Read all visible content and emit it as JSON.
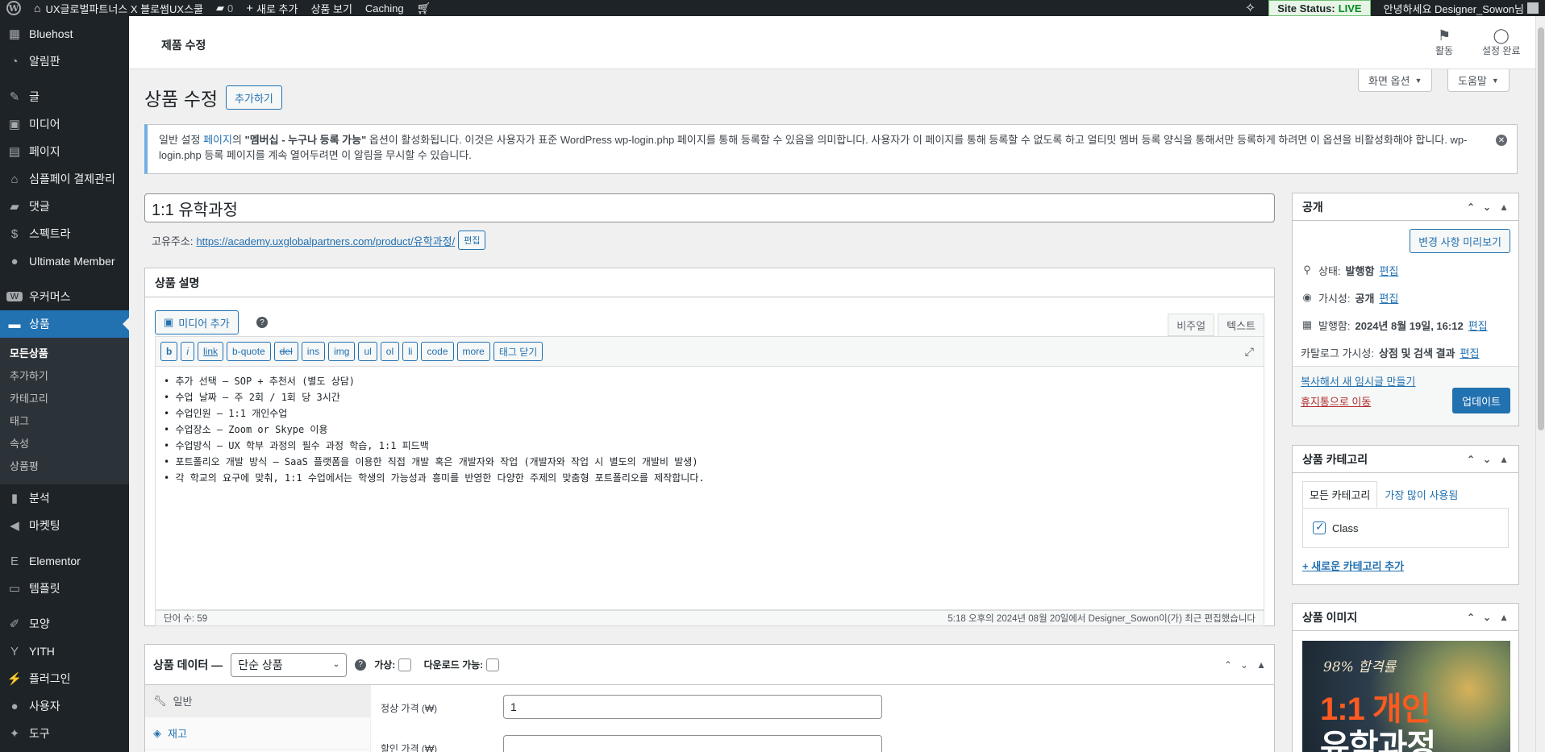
{
  "adminbar": {
    "site_name": "UX글로벌파트너스 X 블로썸UX스쿨",
    "comments_count": "0",
    "new_label": "새로 추가",
    "view_product": "상품 보기",
    "caching": "Caching",
    "site_status_label": "Site Status:",
    "site_status_value": "LIVE",
    "greeting": "안녕하세요 Designer_Sowon님"
  },
  "sidebar": {
    "items": [
      {
        "label": "Bluehost",
        "icon": "grid-icon",
        "glyph": "▦"
      },
      {
        "label": "알림판",
        "icon": "dashboard-icon",
        "glyph": "◔"
      },
      {
        "label": "글",
        "icon": "pin-icon",
        "glyph": "✎"
      },
      {
        "label": "미디어",
        "icon": "media-icon",
        "glyph": "▣"
      },
      {
        "label": "페이지",
        "icon": "page-icon",
        "glyph": "▤"
      },
      {
        "label": "심플페이 결제관리",
        "icon": "bank-icon",
        "glyph": "⌂"
      },
      {
        "label": "댓글",
        "icon": "comment-icon",
        "glyph": "▰"
      },
      {
        "label": "스펙트라",
        "icon": "spectra-icon",
        "glyph": "$"
      },
      {
        "label": "Ultimate Member",
        "icon": "user-icon",
        "glyph": "●"
      },
      {
        "label": "우커머스",
        "icon": "woo-icon",
        "glyph": "W"
      },
      {
        "label": "상품",
        "icon": "archive-icon",
        "glyph": "▬"
      },
      {
        "label": "분석",
        "icon": "chart-icon",
        "glyph": "▮"
      },
      {
        "label": "마켓팅",
        "icon": "megaphone-icon",
        "glyph": "◀"
      },
      {
        "label": "Elementor",
        "icon": "elementor-icon",
        "glyph": "E"
      },
      {
        "label": "템플릿",
        "icon": "folder-icon",
        "glyph": "▭"
      },
      {
        "label": "모양",
        "icon": "brush-icon",
        "glyph": "✐"
      },
      {
        "label": "YITH",
        "icon": "yith-icon",
        "glyph": "Y"
      },
      {
        "label": "플러그인",
        "icon": "plugin-icon",
        "glyph": "⚡"
      },
      {
        "label": "사용자",
        "icon": "users-icon",
        "glyph": "●"
      },
      {
        "label": "도구",
        "icon": "tool-icon",
        "glyph": "✦"
      }
    ],
    "submenu": [
      "모든상품",
      "추가하기",
      "카테고리",
      "태그",
      "속성",
      "상품평"
    ]
  },
  "header": {
    "title": "제품 수정",
    "activity": "활동",
    "setup_done": "설정 완료",
    "screen_options": "화면 옵션",
    "help": "도움말"
  },
  "page": {
    "title": "상품 수정",
    "add_new": "추가하기"
  },
  "notice": {
    "part1": "일반 설정 ",
    "link": "페이지",
    "part2": "의 ",
    "bold": "\"멤버십 - 누구나 등록 가능\"",
    "part3": " 옵션이 활성화됩니다. 이것은 사용자가 표준 WordPress wp-login.php 페이지를 통해 등록할 수 있음을 의미합니다. 사용자가 이 페이지를 통해 등록할 수 없도록 하고 얼티밋 멤버 등록 양식을 통해서만 등록하게 하려면 이 옵션을 비활성화해야 합니다. wp-login.php 등록 페이지를 계속 열어두려면 이 알림을 무시할 수 있습니다."
  },
  "post": {
    "title": "1:1 유학과정",
    "permalink_label": "고유주소:",
    "permalink_url": "https://academy.uxglobalpartners.com/product/유학과정/",
    "edit": "편집"
  },
  "description": {
    "box_title": "상품 설명",
    "add_media": "미디어 추가",
    "tab_visual": "비주얼",
    "tab_text": "텍스트",
    "toolbar": [
      "b",
      "i",
      "link",
      "b-quote",
      "del",
      "ins",
      "img",
      "ul",
      "ol",
      "li",
      "code",
      "more",
      "태그 닫기"
    ],
    "lines": [
      "• 추가 선택 – SOP + 추천서 (별도 상담)",
      "• 수업 날짜 – 주 2회 / 1회 당 3시간",
      "• 수업인원 – 1:1 개인수업",
      "• 수업장소 – Zoom or Skype 이용",
      "• 수업방식 – UX 학부 과정의 필수 과정 학습, 1:1 피드백",
      "• 포트폴리오 개발 방식 – SaaS 플랫폼을 이용한 직접 개발 혹은 개발자와 작업 (개발자와 작업 시 별도의 개발비 발생)",
      "• 각 학교의 요구에 맞춰, 1:1 수업에서는 학생의 가능성과 흥미를 반영한 다양한 주제의 맞춤형 포트폴리오를 제작합니다."
    ],
    "word_count": "단어 수: 59",
    "last_edited": "5:18 오후의 2024년 08월 20일에서 Designer_Sowon이(가) 최근 편집했습니다"
  },
  "product_data": {
    "title": "상품 데이터 —",
    "type": "단순 상품",
    "virtual": "가상:",
    "downloadable": "다운로드 가능:",
    "tabs": [
      "일반",
      "재고"
    ],
    "regular_price_label": "정상 가격 (₩)",
    "regular_price": "1",
    "sale_price_label": "할인 가격 (₩)",
    "sale_price": ""
  },
  "publish": {
    "title": "공개",
    "preview": "변경 사항 미리보기",
    "status_label": "상태:",
    "status_value": "발행함",
    "visibility_label": "가시성:",
    "visibility_value": "공개",
    "published_label": "발행함:",
    "published_value": "2024년 8월 19일, 16:12",
    "catalog_label": "카탈로그 가시성:",
    "catalog_value": "상점 및 검색 결과",
    "edit": "편집",
    "copy_draft": "복사해서 새 임시글 만들기",
    "trash": "휴지통으로 이동",
    "update": "업데이트"
  },
  "categories": {
    "title": "상품 카테고리",
    "tab_all": "모든 카테고리",
    "tab_popular": "가장 많이 사용됨",
    "item": "Class",
    "add_new": "+ 새로운 카테고리 추가"
  },
  "product_image": {
    "title": "상품 이미지",
    "text1": "98% 합격률",
    "text2": "1:1 개인",
    "text3": "유학과정"
  },
  "colors": {
    "accent": "#2271b1",
    "sidebar": "#1d2327",
    "live": "#008a20",
    "trash": "#b32d2e"
  }
}
